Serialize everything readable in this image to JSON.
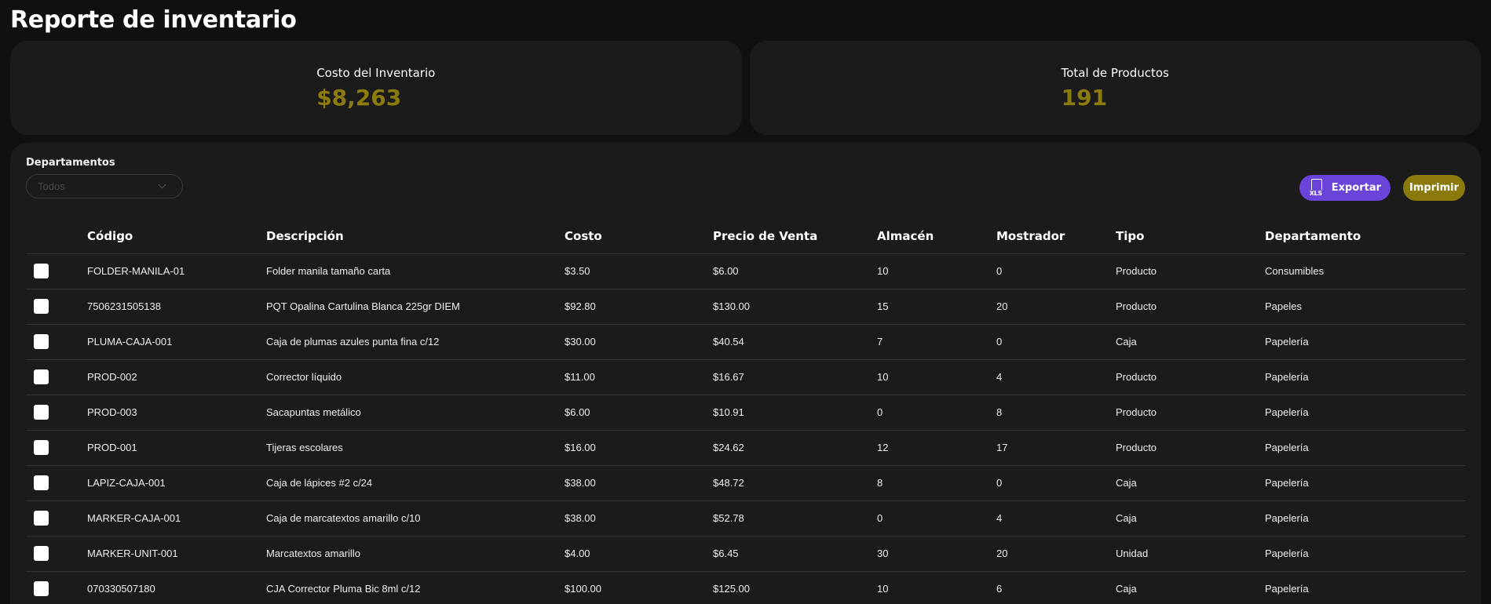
{
  "page": {
    "title": "Reporte de inventario"
  },
  "cards": [
    {
      "label": "Costo del Inventario",
      "value": "$8,263"
    },
    {
      "label": "Total de Productos",
      "value": "191"
    }
  ],
  "filters": {
    "department_label": "Departamentos",
    "department_selected": "Todos"
  },
  "actions": {
    "export_label": "Exportar",
    "export_icon_text": "XLS",
    "print_label": "Imprimir"
  },
  "colors": {
    "accent_gold": "#8c7b0f",
    "export_purple": "#6a44d8",
    "panel_bg": "#1b1b1b"
  },
  "table": {
    "headers": [
      "Código",
      "Descripción",
      "Costo",
      "Precio de Venta",
      "Almacén",
      "Mostrador",
      "Tipo",
      "Departamento"
    ],
    "rows": [
      [
        "FOLDER-MANILA-01",
        "Folder manila tamaño carta",
        "$3.50",
        "$6.00",
        "10",
        "0",
        "Producto",
        "Consumibles"
      ],
      [
        "7506231505138",
        "PQT Opalina Cartulina Blanca 225gr DIEM",
        "$92.80",
        "$130.00",
        "15",
        "20",
        "Producto",
        "Papeles"
      ],
      [
        "PLUMA-CAJA-001",
        "Caja de plumas azules punta fina c/12",
        "$30.00",
        "$40.54",
        "7",
        "0",
        "Caja",
        "Papelería"
      ],
      [
        "PROD-002",
        "Corrector líquido",
        "$11.00",
        "$16.67",
        "10",
        "4",
        "Producto",
        "Papelería"
      ],
      [
        "PROD-003",
        "Sacapuntas metálico",
        "$6.00",
        "$10.91",
        "0",
        "8",
        "Producto",
        "Papelería"
      ],
      [
        "PROD-001",
        "Tijeras escolares",
        "$16.00",
        "$24.62",
        "12",
        "17",
        "Producto",
        "Papelería"
      ],
      [
        "LAPIZ-CAJA-001",
        "Caja de lápices #2 c/24",
        "$38.00",
        "$48.72",
        "8",
        "0",
        "Caja",
        "Papelería"
      ],
      [
        "MARKER-CAJA-001",
        "Caja de marcatextos amarillo c/10",
        "$38.00",
        "$52.78",
        "0",
        "4",
        "Caja",
        "Papelería"
      ],
      [
        "MARKER-UNIT-001",
        "Marcatextos amarillo",
        "$4.00",
        "$6.45",
        "30",
        "20",
        "Unidad",
        "Papelería"
      ],
      [
        "070330507180",
        "CJA Corrector Pluma Bic 8ml c/12",
        "$100.00",
        "$125.00",
        "10",
        "6",
        "Caja",
        "Papelería"
      ]
    ]
  }
}
